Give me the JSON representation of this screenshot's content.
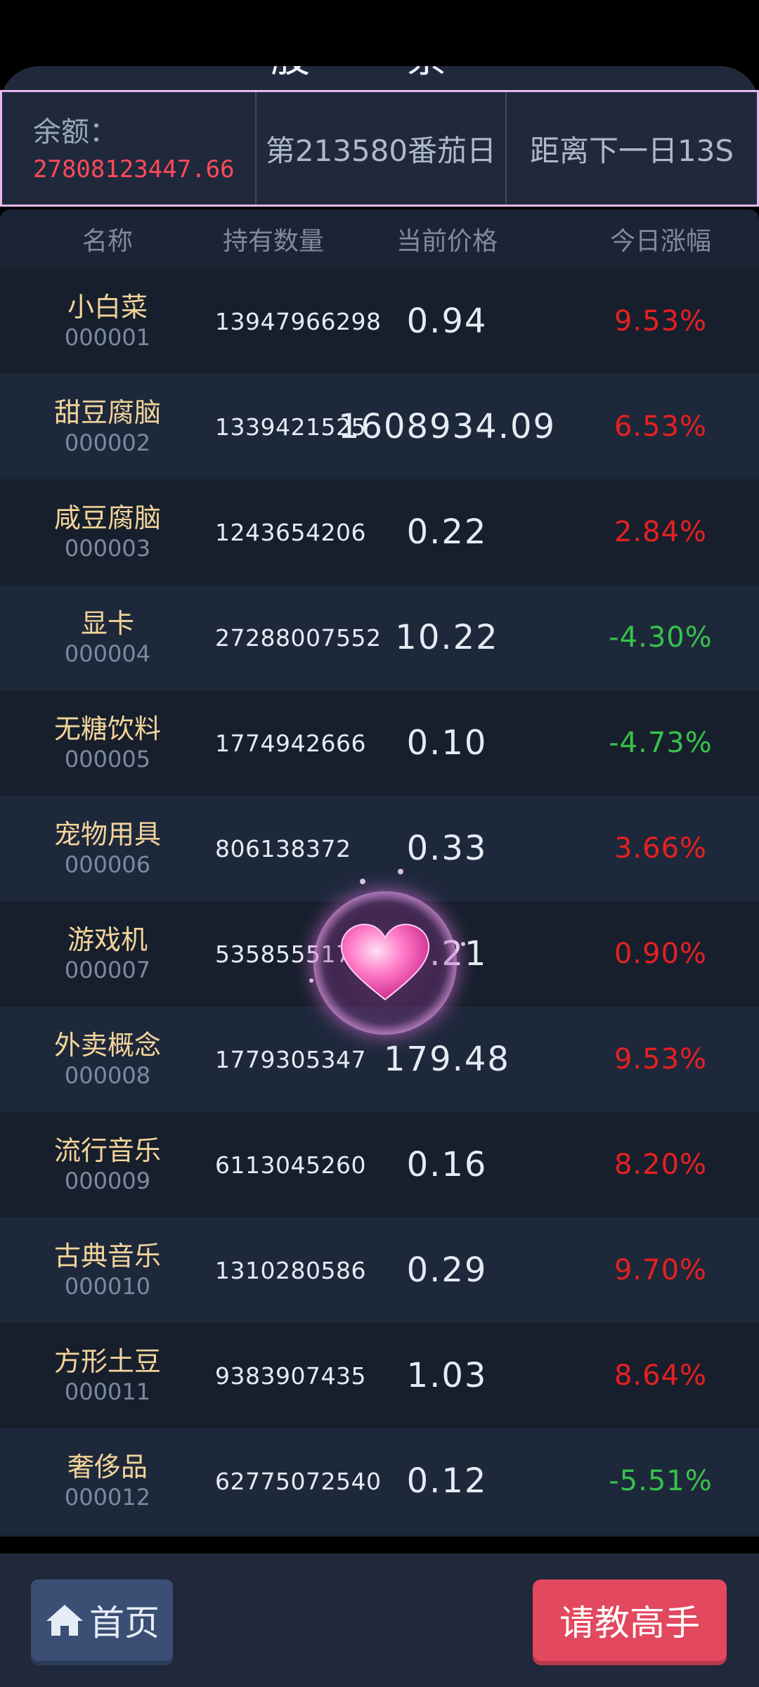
{
  "header": {
    "title": "股 票",
    "balance_label": "余额：",
    "balance_value": "27808123447.66",
    "day_text": "第213580番茄日",
    "next_day_text": "距离下一日13S"
  },
  "table": {
    "columns": [
      "名称",
      "持有数量",
      "当前价格",
      "今日涨幅"
    ],
    "rows": [
      {
        "name": "小白菜",
        "code": "000001",
        "hold": "13947966298",
        "price": "0.94",
        "change": "9.53%",
        "trend": "up"
      },
      {
        "name": "甜豆腐脑",
        "code": "000002",
        "hold": "1339421525",
        "price": "1608934.09",
        "change": "6.53%",
        "trend": "up"
      },
      {
        "name": "咸豆腐脑",
        "code": "000003",
        "hold": "1243654206",
        "price": "0.22",
        "change": "2.84%",
        "trend": "up"
      },
      {
        "name": "显卡",
        "code": "000004",
        "hold": "27288007552",
        "price": "10.22",
        "change": "-4.30%",
        "trend": "down"
      },
      {
        "name": "无糖饮料",
        "code": "000005",
        "hold": "1774942666",
        "price": "0.10",
        "change": "-4.73%",
        "trend": "down"
      },
      {
        "name": "宠物用具",
        "code": "000006",
        "hold": "806138372",
        "price": "0.33",
        "change": "3.66%",
        "trend": "up"
      },
      {
        "name": "游戏机",
        "code": "000007",
        "hold": "5358555178",
        "price": "0.21",
        "change": "0.90%",
        "trend": "up"
      },
      {
        "name": "外卖概念",
        "code": "000008",
        "hold": "1779305347",
        "price": "179.48",
        "change": "9.53%",
        "trend": "up"
      },
      {
        "name": "流行音乐",
        "code": "000009",
        "hold": "6113045260",
        "price": "0.16",
        "change": "8.20%",
        "trend": "up"
      },
      {
        "name": "古典音乐",
        "code": "000010",
        "hold": "1310280586",
        "price": "0.29",
        "change": "9.70%",
        "trend": "up"
      },
      {
        "name": "方形土豆",
        "code": "000011",
        "hold": "9383907435",
        "price": "1.03",
        "change": "8.64%",
        "trend": "up"
      },
      {
        "name": "奢侈品",
        "code": "000012",
        "hold": "62775072540",
        "price": "0.12",
        "change": "-5.51%",
        "trend": "down"
      }
    ]
  },
  "bottom": {
    "home_label": "首页",
    "home_icon": "home-icon",
    "ask_label": "请教高手"
  },
  "overlay": {
    "icon": "heart-icon"
  },
  "colors": {
    "up": "#e62020",
    "down": "#36c24a",
    "name": "#f2d49a",
    "balance": "#ff4a5a",
    "ask_button": "#e2485e",
    "home_button": "#3b4e73"
  }
}
